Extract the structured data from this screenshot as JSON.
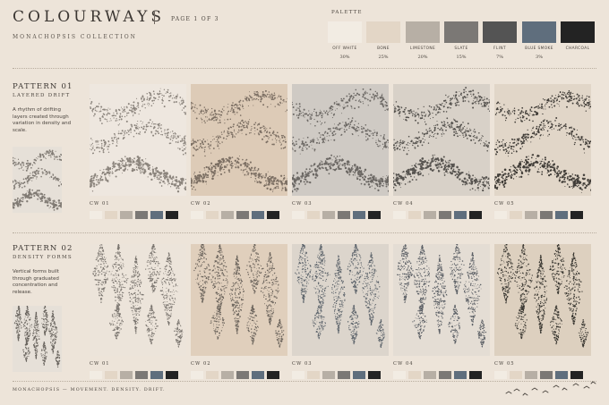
{
  "header": {
    "title": "COLOURWAYS",
    "page": "PAGE 1 OF 3",
    "subtitle": "MONACHOPSIS COLLECTION"
  },
  "palette": {
    "label": "PALETTE",
    "swatches": [
      {
        "name": "OFF WHITE",
        "pct": "30%",
        "color": "#f2ece3"
      },
      {
        "name": "BONE",
        "pct": "25%",
        "color": "#e3d6c6"
      },
      {
        "name": "LIMESTONE",
        "pct": "20%",
        "color": "#b7afa5"
      },
      {
        "name": "SLATE",
        "pct": "15%",
        "color": "#7b7875"
      },
      {
        "name": "FLINT",
        "pct": "7%",
        "color": "#545454"
      },
      {
        "name": "BLUE SMOKE",
        "pct": "3%",
        "color": "#5f6e7d"
      },
      {
        "name": "CHARCOAL",
        "pct": "",
        "color": "#232323"
      }
    ]
  },
  "patterns": [
    {
      "title": "PATTERN 01",
      "subtitle": "LAYERED DRIFT",
      "description": "A rhythm of drifting layers created through variation in density and scale.",
      "kind": "drift",
      "colourways": [
        {
          "label": "CW 01",
          "bg": "#eee7df",
          "ink": "#7a736c"
        },
        {
          "label": "CW 02",
          "bg": "#ddcbb7",
          "ink": "#6b5f55"
        },
        {
          "label": "CW 03",
          "bg": "#cfcac4",
          "ink": "#5a5754"
        },
        {
          "label": "CW 04",
          "bg": "#d8d1c8",
          "ink": "#3f3d3a"
        },
        {
          "label": "CW 05",
          "bg": "#e1d6c8",
          "ink": "#24221f"
        }
      ]
    },
    {
      "title": "PATTERN 02",
      "subtitle": "DENSITY FORMS",
      "description": "Vertical forms built through graduated concentration and release.",
      "kind": "forms",
      "colourways": [
        {
          "label": "CW 01",
          "bg": "#ece4da",
          "ink": "#6d6762"
        },
        {
          "label": "CW 02",
          "bg": "#e0cfbc",
          "ink": "#5d5650"
        },
        {
          "label": "CW 03",
          "bg": "#dcd5cc",
          "ink": "#4f5860"
        },
        {
          "label": "CW 04",
          "bg": "#e4ddd4",
          "ink": "#4a5058"
        },
        {
          "label": "CW 05",
          "bg": "#ddd0bf",
          "ink": "#25231f"
        }
      ]
    }
  ],
  "chip_colors": [
    "#f2ece3",
    "#e3d6c6",
    "#b7afa5",
    "#7b7875",
    "#5f6e7d",
    "#232323"
  ],
  "footer": "MONACHOPSIS — MOVEMENT. DENSITY. DRIFT."
}
